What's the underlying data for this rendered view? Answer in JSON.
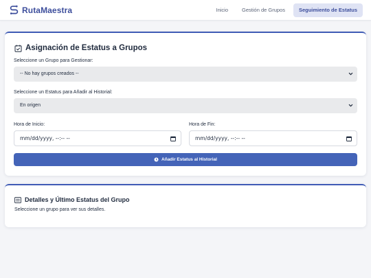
{
  "brand": {
    "name": "RutaMaestra",
    "icon": "route-icon",
    "color": "#3d4e9c"
  },
  "nav": {
    "items": [
      {
        "label": "Inicio",
        "active": false
      },
      {
        "label": "Gestión de Grupos",
        "active": false
      },
      {
        "label": "Seguimiento de Estatus",
        "active": true
      }
    ]
  },
  "status_card": {
    "title": "Asignación de Estatus a Grupos",
    "title_icon": "calendar-check-icon",
    "group_label": "Seleccione un Grupo para Gestionar:",
    "group_value": "-- No hay grupos creados --",
    "status_label": "Seleccione un Estatus para Añadir al Historial:",
    "status_value": "En origen",
    "start_label": "Hora de Inicio:",
    "start_value": "mm/dd/yyyy, --:-- --",
    "end_label": "Hora de Fin:",
    "end_value": "mm/dd/yyyy, --:-- --",
    "submit_label": "Añadir Estatus al Historial",
    "submit_icon": "clock-icon",
    "accent_color": "#4464b8"
  },
  "details_card": {
    "title": "Detalles y Último Estatus del Grupo",
    "title_icon": "list-icon",
    "hint": "Seleccione un grupo para ver sus detalles."
  }
}
